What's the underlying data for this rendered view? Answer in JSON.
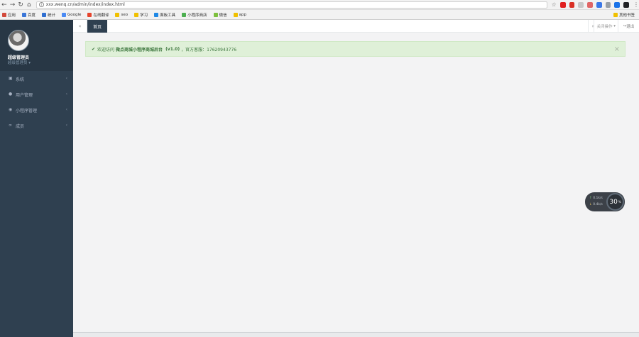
{
  "browser": {
    "url": "xxx.wenq.cn/admin/index/index.html",
    "bookmarks": [
      {
        "label": "应用",
        "color": "#d24a3b"
      },
      {
        "label": "百度",
        "color": "#3a76d8"
      },
      {
        "label": "统计",
        "color": "#2f6fd1"
      },
      {
        "label": "Google",
        "color": "#4a8af4"
      },
      {
        "label": "在线翻译",
        "color": "#e6452d"
      },
      {
        "label": "seo",
        "color": "#f0c000"
      },
      {
        "label": "学习",
        "color": "#f0c000"
      },
      {
        "label": "面板工具",
        "color": "#1e88e5"
      },
      {
        "label": "小程序商店",
        "color": "#4caf50"
      },
      {
        "label": "微信",
        "color": "#7cbf3c"
      },
      {
        "label": "app",
        "color": "#f0c000"
      }
    ],
    "other_bookmarks": "其他书签"
  },
  "sidebar": {
    "profile": {
      "name": "超级管理员",
      "role": "超级管理员"
    },
    "items": [
      {
        "label": "系统",
        "icon": "desktop-icon"
      },
      {
        "label": "用户管理",
        "icon": "user-icon"
      },
      {
        "label": "小程序管理",
        "icon": "wechat-icon"
      },
      {
        "label": "成员",
        "icon": "share-icon"
      }
    ]
  },
  "topbar": {
    "home_tab": "首页",
    "close_ops": "关闭操作",
    "logout": "退出"
  },
  "alert": {
    "prefix": "欢迎访问",
    "title": "微点商城小程序商城后台",
    "version": "(v1.0)",
    "contact": "，官方客服：17620943776"
  },
  "widget": {
    "row1": "0.1k/s",
    "row2": "0.4k/s",
    "value": "30",
    "unit": "%"
  },
  "colors": {
    "sidebar": "#2f4050",
    "alert_bg": "#dff0d8",
    "alert_text": "#3c763d"
  }
}
